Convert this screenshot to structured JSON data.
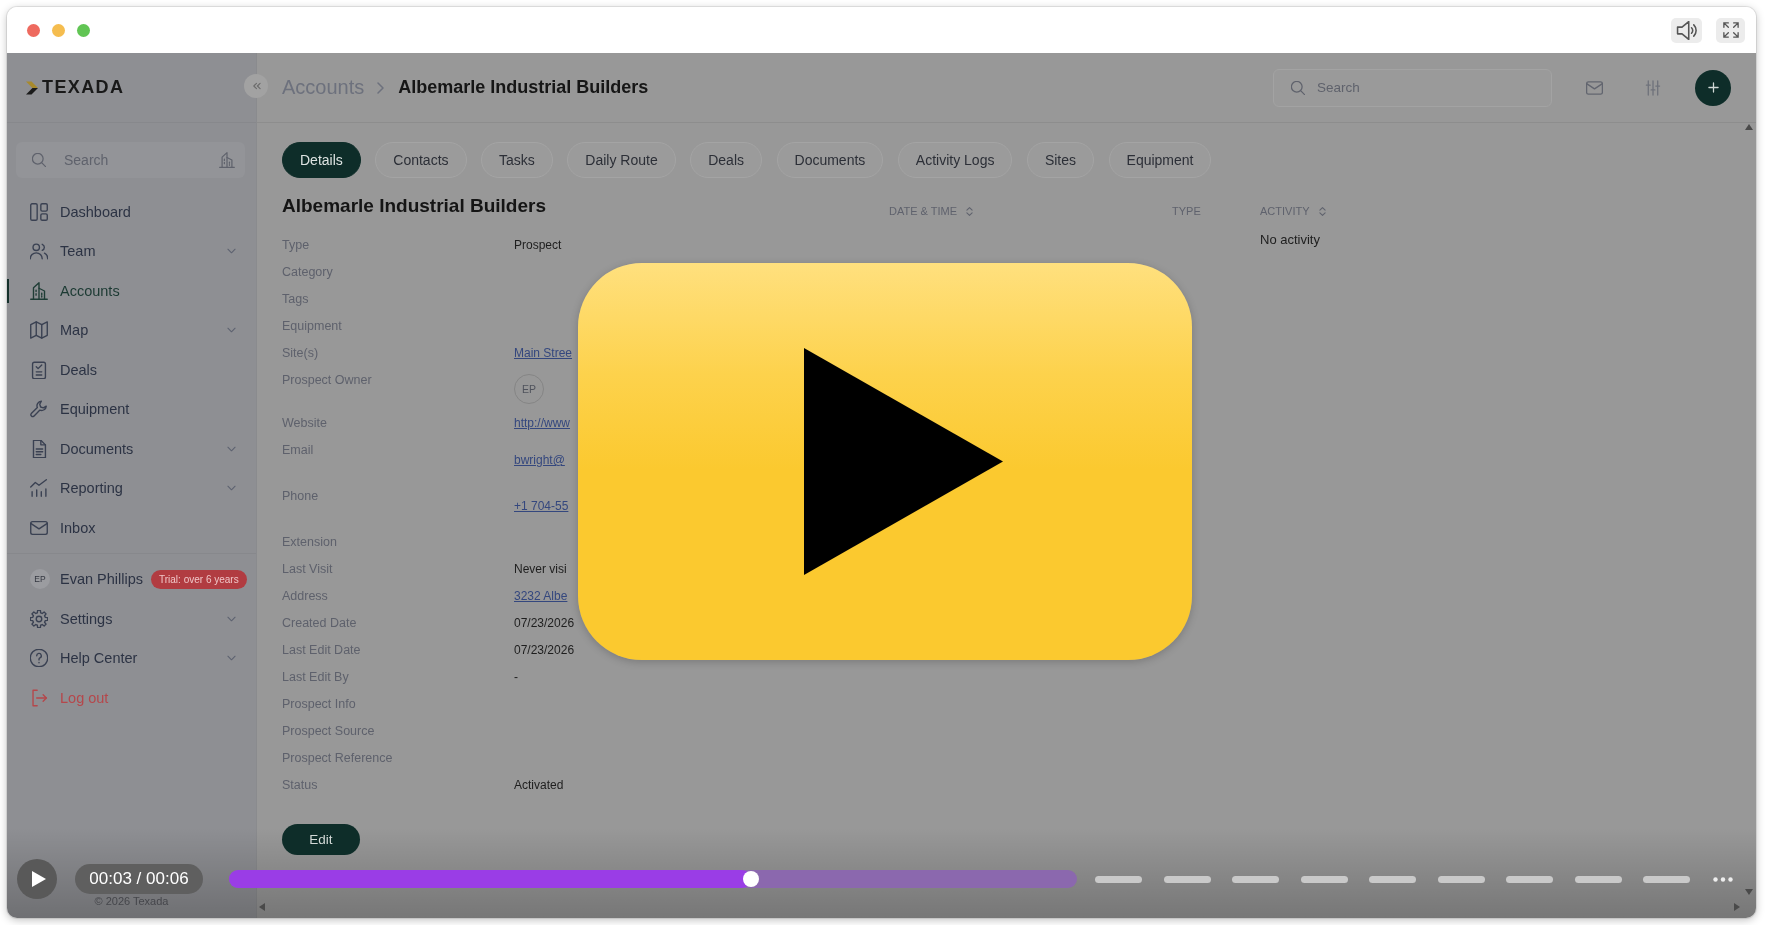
{
  "sidebar": {
    "logo": "TEXADA",
    "search": {
      "placeholder": "Search"
    },
    "items": [
      {
        "label": "Dashboard",
        "has_submenu": false,
        "selected": false
      },
      {
        "label": "Team",
        "has_submenu": true,
        "selected": false
      },
      {
        "label": "Accounts",
        "has_submenu": false,
        "selected": true
      },
      {
        "label": "Map",
        "has_submenu": true,
        "selected": false
      },
      {
        "label": "Deals",
        "has_submenu": false,
        "selected": false
      },
      {
        "label": "Equipment",
        "has_submenu": false,
        "selected": false
      },
      {
        "label": "Documents",
        "has_submenu": true,
        "selected": false
      },
      {
        "label": "Reporting",
        "has_submenu": true,
        "selected": false
      },
      {
        "label": "Inbox",
        "has_submenu": false,
        "selected": false
      }
    ],
    "user": {
      "initials": "EP",
      "name": "Evan Phillips",
      "badge": "Trial: over 6 years"
    },
    "bottom_items": [
      {
        "label": "Settings",
        "kind": "menu",
        "has_submenu": true,
        "selected": false
      },
      {
        "label": "Help Center",
        "kind": "menu",
        "has_submenu": true,
        "selected": false
      },
      {
        "label": "Log out",
        "kind": "logout",
        "has_submenu": false,
        "selected": false
      }
    ],
    "footer": "© 2026 Texada"
  },
  "header": {
    "breadcrumb": [
      {
        "label": "Accounts"
      },
      {
        "label": "Albemarle Industrial Builders"
      }
    ],
    "search": {
      "placeholder": "Search"
    }
  },
  "tabs": [
    {
      "label": "Details",
      "selected": true
    },
    {
      "label": "Contacts",
      "selected": false
    },
    {
      "label": "Tasks",
      "selected": false
    },
    {
      "label": "Daily Route",
      "selected": false
    },
    {
      "label": "Deals",
      "selected": false
    },
    {
      "label": "Documents",
      "selected": false
    },
    {
      "label": "Activity Logs",
      "selected": false
    },
    {
      "label": "Sites",
      "selected": false
    },
    {
      "label": "Equipment",
      "selected": false
    }
  ],
  "details": {
    "title": "Albemarle Industrial Builders",
    "fields": [
      {
        "label": "Type",
        "kind": "text",
        "value": "Prospect"
      },
      {
        "label": "Category",
        "kind": "text"
      },
      {
        "label": "Tags",
        "kind": "text"
      },
      {
        "label": "Equipment",
        "kind": "text"
      },
      {
        "label": "Site(s)",
        "kind": "link",
        "value": "Main Stree"
      },
      {
        "label": "Prospect Owner",
        "kind": "avatar",
        "value": "EP"
      },
      {
        "label": "Website",
        "kind": "link",
        "value": "http://www"
      },
      {
        "label": "Email",
        "kind": "contact",
        "value": "bwright@"
      },
      {
        "label": "Phone",
        "kind": "contact",
        "value": "+1 704-55"
      },
      {
        "label": "Extension",
        "kind": "text"
      },
      {
        "label": "Last Visit",
        "kind": "text",
        "value": "Never visi"
      },
      {
        "label": "Address",
        "kind": "link",
        "value": "3232 Albe"
      },
      {
        "label": "Created Date",
        "kind": "text",
        "value": "07/23/2026"
      },
      {
        "label": "Last Edit Date",
        "kind": "text",
        "value": "07/23/2026"
      },
      {
        "label": "Last Edit By",
        "kind": "text",
        "value": "-"
      },
      {
        "label": "Prospect Info",
        "kind": "text"
      },
      {
        "label": "Prospect Source",
        "kind": "text"
      },
      {
        "label": "Prospect Reference",
        "kind": "text"
      },
      {
        "label": "Status",
        "kind": "text",
        "value": "Activated"
      }
    ],
    "edit_button": "Edit"
  },
  "activity": {
    "columns": [
      {
        "label": "DATE & TIME",
        "sortable": true
      },
      {
        "label": "TYPE",
        "sortable": false
      },
      {
        "label": "ACTIVITY",
        "sortable": true
      }
    ],
    "empty": "No activity"
  },
  "player": {
    "playing": false,
    "time": "00:03 / 00:06",
    "level": 0.615
  }
}
